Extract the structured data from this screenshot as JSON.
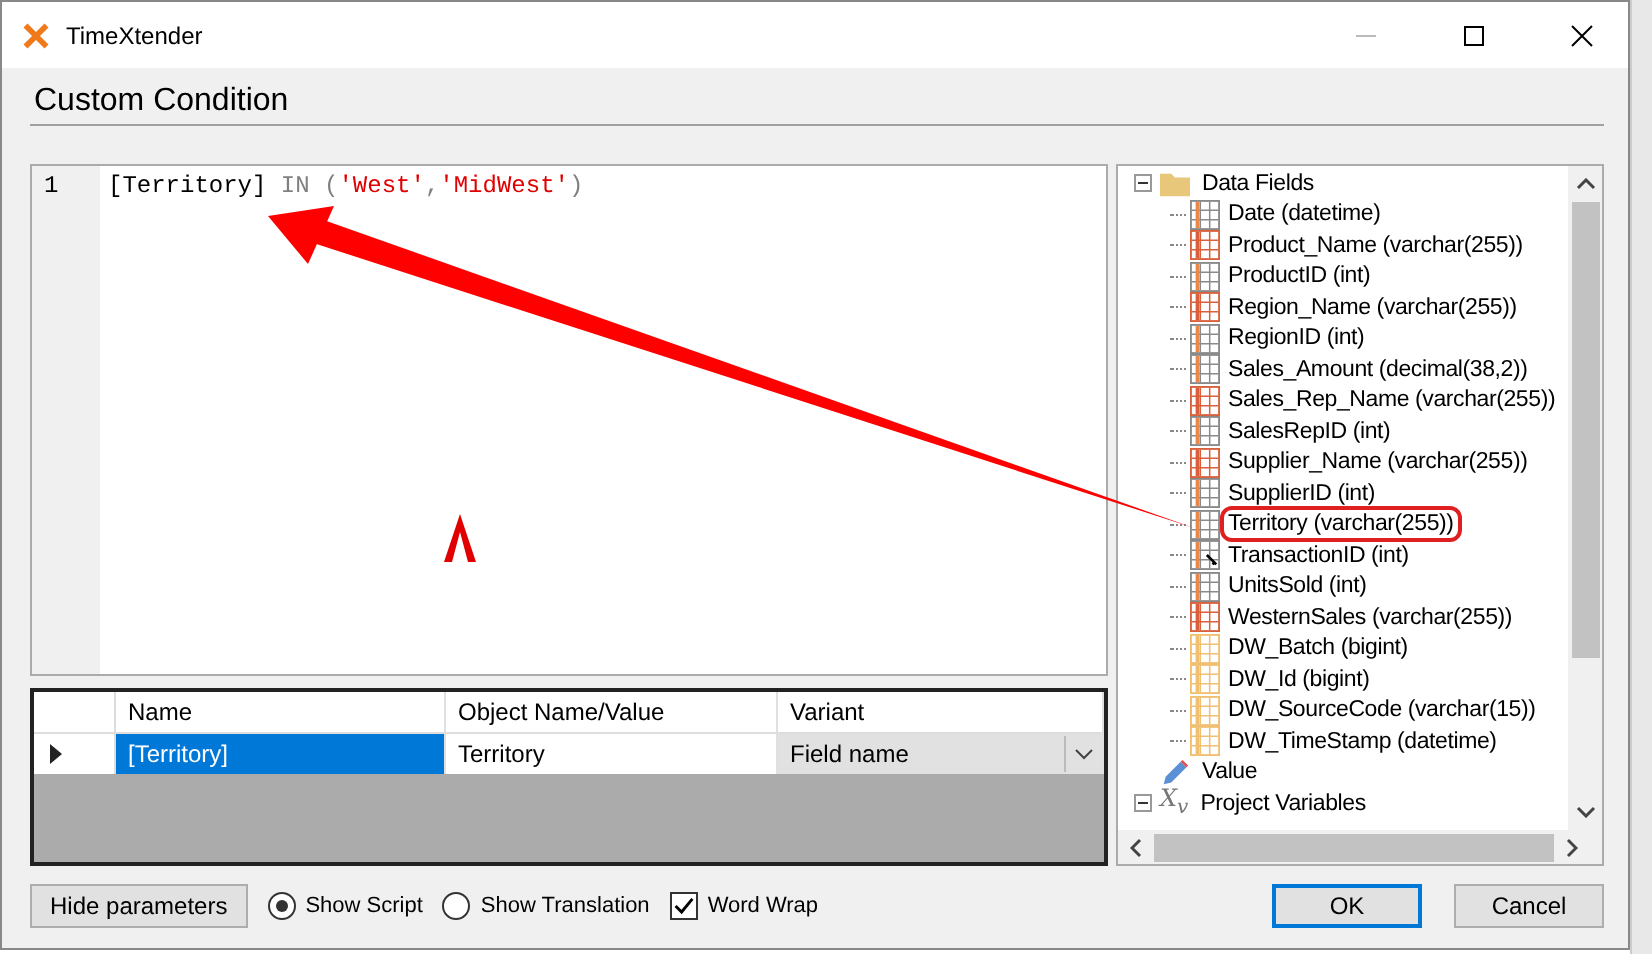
{
  "window": {
    "title": "TimeXtender"
  },
  "heading": "Custom Condition",
  "editor": {
    "line_number": "1",
    "tokens": [
      {
        "kind": "field",
        "text": "[Territory]"
      },
      {
        "kind": "keyword",
        "text": " IN ("
      },
      {
        "kind": "string",
        "text": "'West'"
      },
      {
        "kind": "punct",
        "text": ","
      },
      {
        "kind": "string",
        "text": "'MidWest'"
      },
      {
        "kind": "punct",
        "text": ")"
      }
    ]
  },
  "parameters": {
    "columns": [
      "Name",
      "Object Name/Value",
      "Variant"
    ],
    "rows": [
      {
        "selected": true,
        "cells": [
          "[Territory]",
          "Territory",
          "Field name"
        ]
      }
    ]
  },
  "tree": [
    {
      "label": "Data Fields",
      "kind": "folder",
      "expanded": true,
      "children": [
        {
          "label": "Date (datetime)",
          "kind": "plain",
          "highlighted": false
        },
        {
          "label": "Product_Name (varchar(255))",
          "kind": "text",
          "highlighted": false
        },
        {
          "label": "ProductID (int)",
          "kind": "plain",
          "highlighted": false
        },
        {
          "label": "Region_Name (varchar(255))",
          "kind": "text",
          "highlighted": false
        },
        {
          "label": "RegionID (int)",
          "kind": "plain",
          "highlighted": false
        },
        {
          "label": "Sales_Amount (decimal(38,2))",
          "kind": "plain",
          "highlighted": false
        },
        {
          "label": "Sales_Rep_Name (varchar(255))",
          "kind": "text",
          "highlighted": false
        },
        {
          "label": "SalesRepID (int)",
          "kind": "plain",
          "highlighted": false
        },
        {
          "label": "Supplier_Name (varchar(255))",
          "kind": "text",
          "highlighted": false
        },
        {
          "label": "SupplierID (int)",
          "kind": "plain",
          "highlighted": false
        },
        {
          "label": "Territory (varchar(255))",
          "kind": "plain",
          "highlighted": true
        },
        {
          "label": "TransactionID (int)",
          "kind": "key",
          "highlighted": false
        },
        {
          "label": "UnitsSold (int)",
          "kind": "plain",
          "highlighted": false
        },
        {
          "label": "WesternSales (varchar(255))",
          "kind": "text",
          "highlighted": false
        },
        {
          "label": "DW_Batch (bigint)",
          "kind": "system",
          "highlighted": false
        },
        {
          "label": "DW_Id (bigint)",
          "kind": "system",
          "highlighted": false
        },
        {
          "label": "DW_SourceCode (varchar(15))",
          "kind": "system",
          "highlighted": false
        },
        {
          "label": "DW_TimeStamp (datetime)",
          "kind": "system",
          "highlighted": false
        }
      ]
    },
    {
      "label": "Value",
      "kind": "value"
    },
    {
      "label": "Project Variables",
      "kind": "variables",
      "expanded": true,
      "icon_text": "X$_{v}$"
    }
  ],
  "options": {
    "hide_button": "Hide parameters",
    "radios": [
      {
        "label": "Show Script",
        "selected": true
      },
      {
        "label": "Show Translation",
        "selected": false
      }
    ],
    "checkbox": {
      "label": "Word Wrap",
      "checked": true
    }
  },
  "buttons": [
    {
      "label": "OK",
      "default": true
    },
    {
      "label": "Cancel",
      "default": false
    }
  ]
}
